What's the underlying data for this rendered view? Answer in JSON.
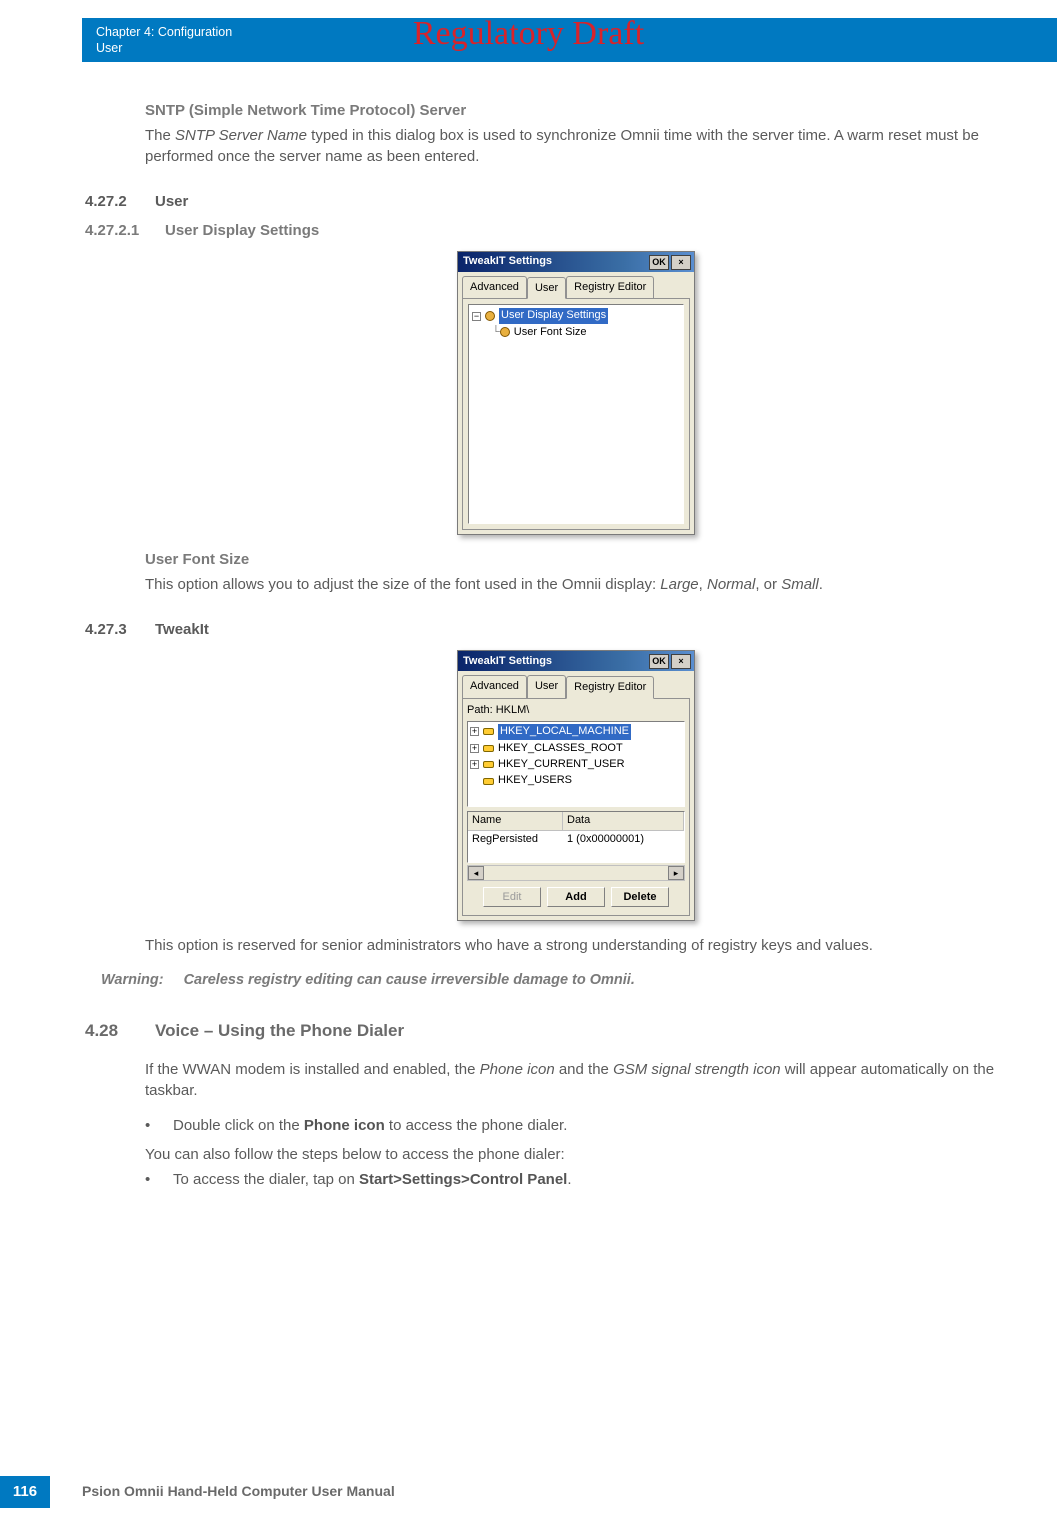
{
  "watermark": "Regulatory Draft",
  "header": {
    "chapter_line": "Chapter 4:  Configuration",
    "section_line": "User"
  },
  "sntp": {
    "heading": "SNTP (Simple Network Time Protocol) Server",
    "para_1": "The ",
    "para_em": "SNTP Server Name",
    "para_2": " typed in this dialog box is used to synchronize Omnii time with the server time. A warm reset must be performed once the server name as been entered."
  },
  "s4272": {
    "num": "4.27.2",
    "title": "User"
  },
  "s42721": {
    "num": "4.27.2.1",
    "title": "User Display Settings"
  },
  "dialog1": {
    "title": "TweakIT Settings",
    "ok": "OK",
    "close": "×",
    "tabs": [
      "Advanced",
      "User",
      "Registry Editor"
    ],
    "active_tab_index": 1,
    "tree_root": "User Display Settings",
    "tree_child": "User Font Size"
  },
  "ufs": {
    "heading": "User Font Size",
    "para_1": "This option allows you to adjust the size of the font used in the Omnii display: ",
    "em1": "Large",
    "sep1": ", ",
    "em2": "Normal",
    "sep2": ", or ",
    "em3": "Small",
    "tail": "."
  },
  "s4273": {
    "num": "4.27.3",
    "title": "TweakIt"
  },
  "dialog2": {
    "title": "TweakIT Settings",
    "ok": "OK",
    "close": "×",
    "tabs": [
      "Advanced",
      "User",
      "Registry Editor"
    ],
    "active_tab_index": 2,
    "path_label": "Path: HKLM\\",
    "keys": [
      "HKEY_LOCAL_MACHINE",
      "HKEY_CLASSES_ROOT",
      "HKEY_CURRENT_USER",
      "HKEY_USERS"
    ],
    "col_name": "Name",
    "col_data": "Data",
    "row_name": "RegPersisted",
    "row_data": "1 (0x00000001)",
    "btn_edit": "Edit",
    "btn_add": "Add",
    "btn_delete": "Delete"
  },
  "tweakit_para": "This option is reserved for senior administrators who have a strong understanding of registry keys and values.",
  "warning": {
    "label": "Warning:",
    "text": "Careless registry editing can cause irreversible damage to Omnii."
  },
  "s428": {
    "num": "4.28",
    "title": "Voice – Using the Phone Dialer"
  },
  "voice": {
    "p1_a": "If the WWAN modem is installed and enabled, the ",
    "p1_em1": "Phone icon",
    "p1_b": " and the ",
    "p1_em2": "GSM signal strength icon",
    "p1_c": " will appear automatically on the taskbar.",
    "b1_a": "Double click on the ",
    "b1_bold": "Phone icon",
    "b1_b": " to access the phone dialer.",
    "p2": "You can also follow the steps below to access the phone dialer:",
    "b2_a": "To access the dialer, tap on ",
    "b2_bold": "Start>Settings>Control Panel",
    "b2_b": "."
  },
  "footer": {
    "page": "116",
    "text": "Psion Omnii Hand-Held Computer User Manual"
  }
}
